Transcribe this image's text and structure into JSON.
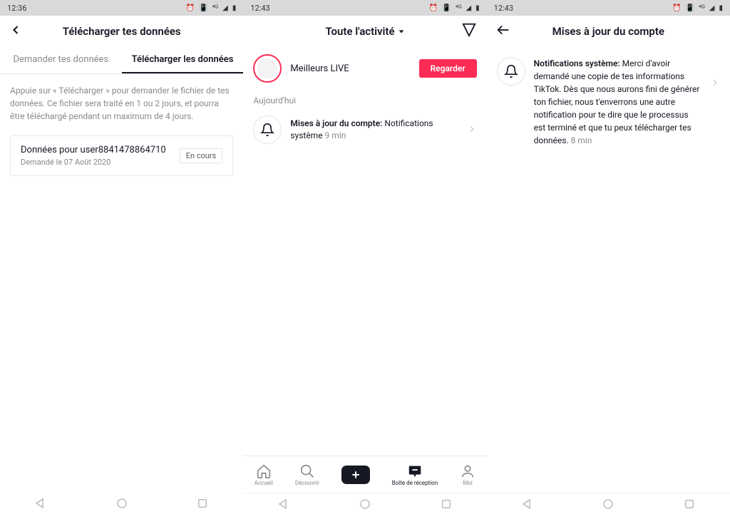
{
  "screen1": {
    "status": {
      "time": "12:36"
    },
    "header": {
      "title": "Télécharger tes données"
    },
    "tabs": {
      "request": "Demander tes données",
      "download": "Télécharger les données"
    },
    "description": "Appuie sur « Télécharger » pour demander le fichier de tes données. Ce fichier sera traité en 1 ou 2 jours, et pourra être téléchargé pendant un maximum de 4 jours.",
    "card": {
      "title": "Données pour user8841478864710",
      "subtitle": "Demandé le 07 Août 2020",
      "status": "En cours"
    }
  },
  "screen2": {
    "status": {
      "time": "12:43"
    },
    "header": {
      "title": "Toute l'activité"
    },
    "live": {
      "label": "Meilleurs LIVE",
      "button": "Regarder"
    },
    "section": "Aujourd'hui",
    "notif": {
      "bold": "Mises à jour du compte:",
      "text": " Notifications système",
      "time": " 9 min"
    },
    "nav": {
      "home": "Accueil",
      "discover": "Découvrir",
      "inbox": "Boîte de réception",
      "me": "Moi"
    }
  },
  "screen3": {
    "status": {
      "time": "12:43"
    },
    "header": {
      "title": "Mises à jour du compte"
    },
    "detail": {
      "bold": "Notifications système:",
      "text": " Merci d'avoir demandé une copie de tes informations TikTok. Dès que nous aurons fini de générer ton fichier, nous t'enverrons une autre notification pour te dire que le processus est terminé et que tu peux télécharger tes données.",
      "time": " 8 min"
    }
  }
}
